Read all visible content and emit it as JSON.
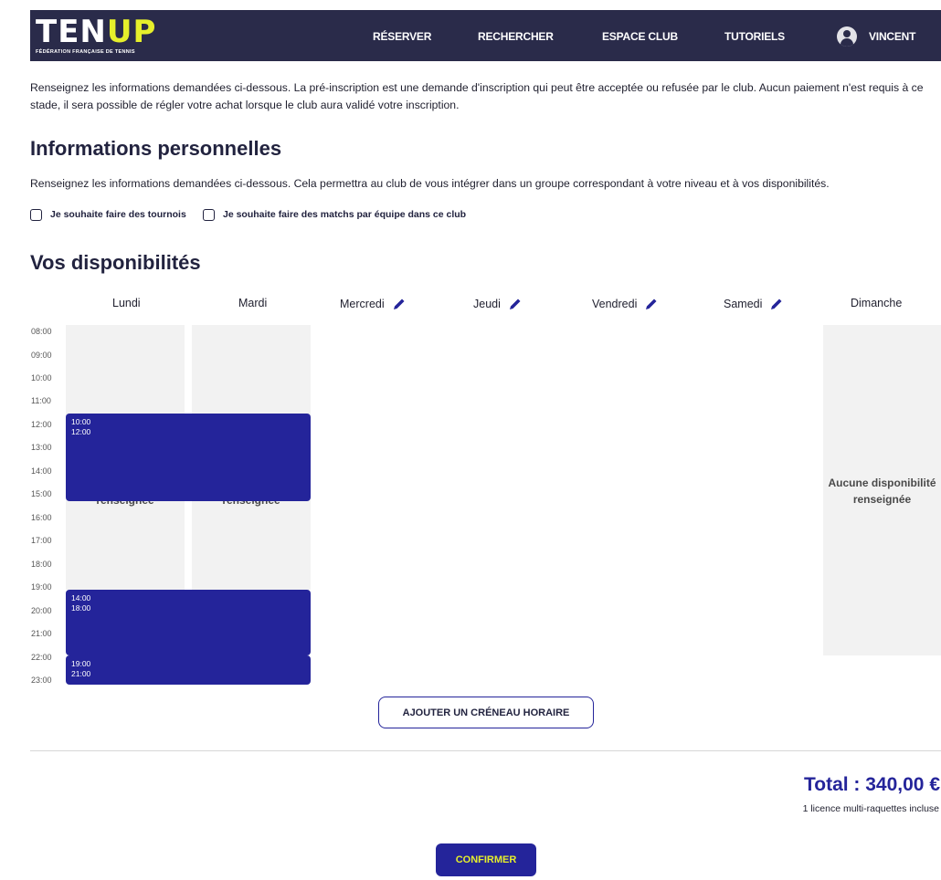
{
  "header": {
    "logo_text_main": "TEN",
    "logo_text_accent": "UP",
    "logo_subtitle": "FÉDÉRATION FRANÇAISE DE TENNIS",
    "nav": [
      "RÉSERVER",
      "RECHERCHER",
      "ESPACE CLUB",
      "TUTORIELS"
    ],
    "user_name": "VINCENT",
    "colors": {
      "bar": "#2a2b4a",
      "accent": "#e6ef2b"
    }
  },
  "intro": "Renseignez les informations demandées ci-dessous. La pré-inscription est une demande d'inscription qui peut être acceptée ou refusée par le club. Aucun paiement n'est requis à ce stade, il sera possible de régler votre achat lorsque le club aura validé votre inscription.",
  "personal": {
    "title": "Informations personnelles",
    "description": "Renseignez les informations demandées ci-dessous. Cela permettra au club de vous intégrer dans un groupe correspondant à votre niveau et à vos disponibilités.",
    "checkbox_tournaments": "Je souhaite faire des tournois",
    "checkbox_team": "Je souhaite faire des matchs par équipe dans ce club"
  },
  "availability": {
    "title": "Vos disponibilités",
    "days": [
      "Lundi",
      "Mardi",
      "Mercredi",
      "Jeudi",
      "Vendredi",
      "Samedi",
      "Dimanche"
    ],
    "hours": [
      "08:00",
      "09:00",
      "10:00",
      "11:00",
      "12:00",
      "13:00",
      "14:00",
      "15:00",
      "16:00",
      "17:00",
      "18:00",
      "19:00",
      "20:00",
      "21:00",
      "22:00",
      "23:00"
    ],
    "empty_text_line1": "Aucune disponibilité",
    "empty_text_line2": "renseignée",
    "behind_text": "renseignée",
    "slots": [
      {
        "start": "10:00",
        "end": "12:00"
      },
      {
        "start": "14:00",
        "end": "18:00"
      },
      {
        "start": "19:00",
        "end": "21:00"
      }
    ],
    "add_button": "AJOUTER UN CRÉNEAU HORAIRE",
    "slot_color": "#24249a"
  },
  "total": {
    "label": "Total : 340,00 €",
    "licence": "1 licence multi-raquettes incluse"
  },
  "confirm_button": "CONFIRMER"
}
